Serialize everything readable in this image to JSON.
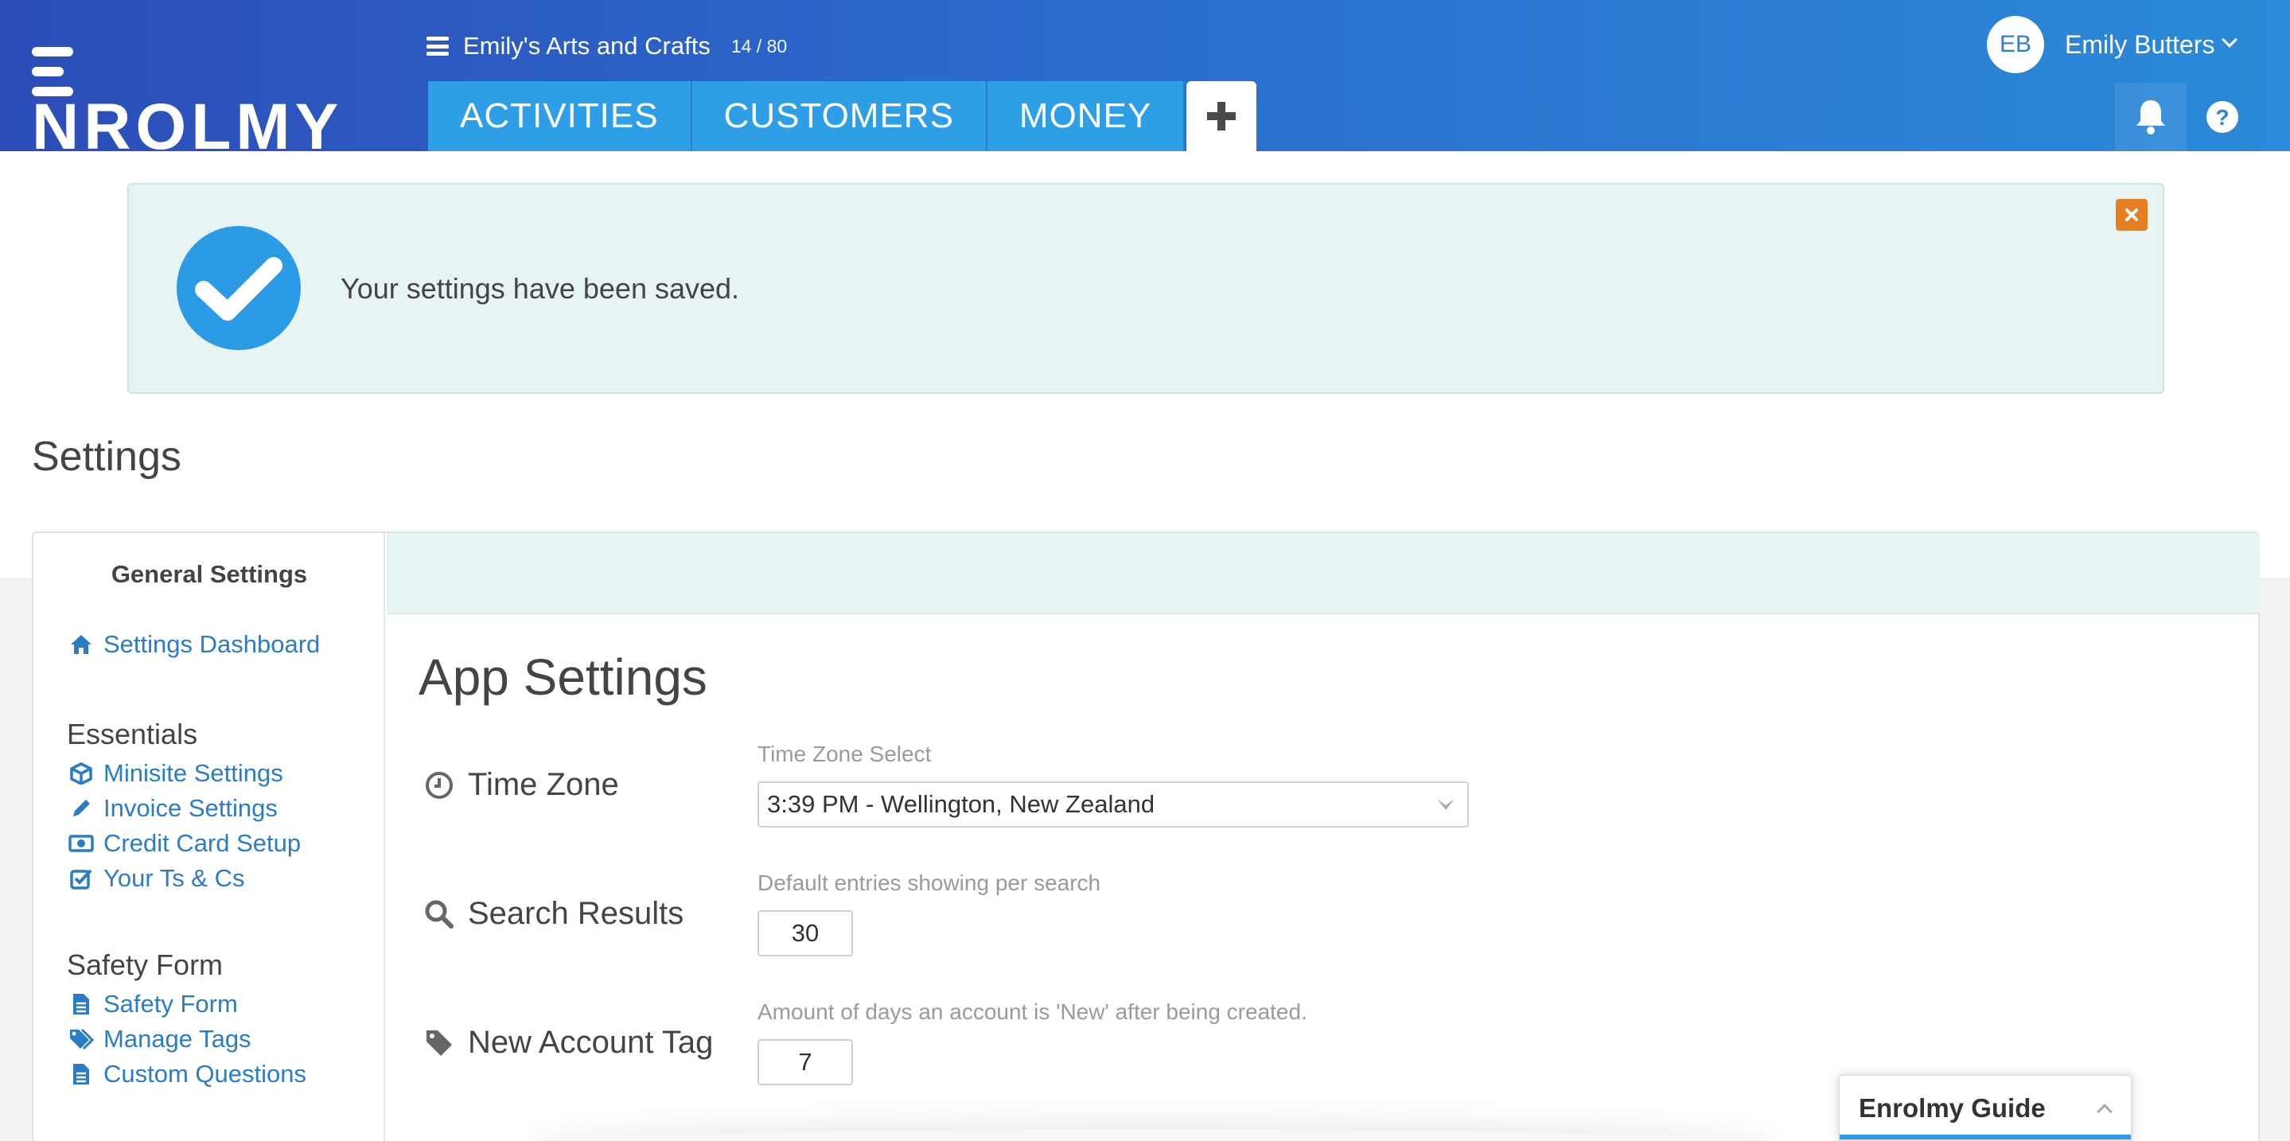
{
  "header": {
    "logo": "ENROLMY",
    "org_name": "Emily's Arts and Crafts",
    "org_count": "14 / 80",
    "tabs": [
      {
        "label": "ACTIVITIES"
      },
      {
        "label": "CUSTOMERS"
      },
      {
        "label": "MONEY"
      }
    ],
    "add_tab_icon": "plus-icon",
    "user": {
      "initials": "EB",
      "name": "Emily Butters"
    },
    "icons": [
      "bell-icon",
      "help-icon"
    ]
  },
  "alert": {
    "message": "Your settings have been saved.",
    "icon": "check-circle-icon",
    "close_icon": "close-icon"
  },
  "page": {
    "title": "Settings"
  },
  "sidebar": {
    "title": "General Settings",
    "dashboard": {
      "label": "Settings Dashboard",
      "icon": "home-icon"
    },
    "sections": [
      {
        "heading": "Essentials",
        "items": [
          {
            "label": "Minisite Settings",
            "icon": "cube-icon"
          },
          {
            "label": "Invoice Settings",
            "icon": "pencil-icon"
          },
          {
            "label": "Credit Card Setup",
            "icon": "money-icon"
          },
          {
            "label": "Your Ts & Cs",
            "icon": "checkbox-icon"
          }
        ]
      },
      {
        "heading": "Safety Form",
        "items": [
          {
            "label": "Safety Form",
            "icon": "document-icon"
          },
          {
            "label": "Manage Tags",
            "icon": "tags-icon"
          },
          {
            "label": "Custom Questions",
            "icon": "document-icon"
          }
        ]
      }
    ]
  },
  "main": {
    "title": "App Settings",
    "rows": [
      {
        "label": "Time Zone",
        "icon": "clock-icon",
        "caption": "Time Zone Select",
        "value": "3:39 PM - Wellington, New Zealand"
      },
      {
        "label": "Search Results",
        "icon": "search-icon",
        "caption": "Default entries showing per search",
        "value": "30"
      },
      {
        "label": "New Account Tag",
        "icon": "tag-icon",
        "caption": "Amount of days an account is 'New' after being created.",
        "value": "7"
      }
    ]
  },
  "guide": {
    "title": "Enrolmy Guide"
  },
  "colors": {
    "brand_blue": "#2c9be5",
    "alert_bg": "#e8f4f3",
    "close_orange": "#e67e22",
    "link_blue": "#2a7cc7"
  }
}
